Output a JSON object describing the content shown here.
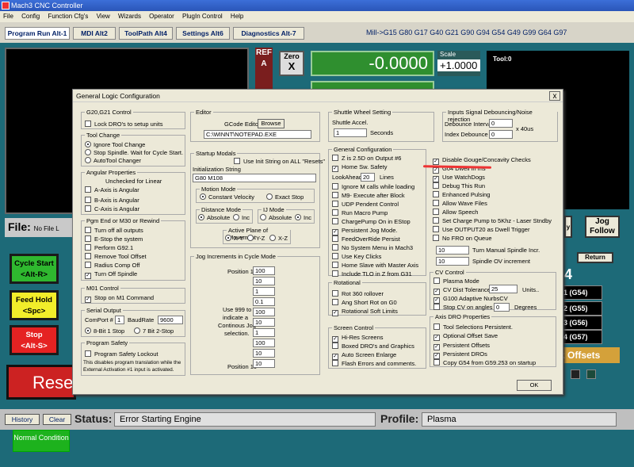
{
  "window": {
    "title": "Mach3 CNC Controller"
  },
  "menu": [
    "File",
    "Config",
    "Function Cfg's",
    "View",
    "Wizards",
    "Operator",
    "PlugIn Control",
    "Help"
  ],
  "tabs": [
    "Program Run Alt-1",
    "MDI Alt2",
    "ToolPath Alt4",
    "Settings Alt6",
    "Diagnostics Alt-7"
  ],
  "gcodes_line": "Mill->G15  G80 G17 G40 G21 G90 G94 G54 G49 G99 G64 G97",
  "ref_label": "REF A",
  "zero": {
    "line1": "Zero",
    "line2": "X"
  },
  "dro_value": "-0.0000",
  "scale": {
    "label": "Scale",
    "value": "+1.0000"
  },
  "tool_label": "Tool:0",
  "file": {
    "label": "File:",
    "value": "No File L"
  },
  "left_buttons": {
    "cycle_start": "Cycle Start",
    "cycle_key": "<Alt-R>",
    "feed_hold": "Feed Hold",
    "feed_key": "<Spc>",
    "stop": "Stop",
    "stop_key": "<Alt-S>",
    "reset": "Rese"
  },
  "right_panel": {
    "jog_follow": "Jog Follow",
    "jog_partial": "y",
    "return": "Return",
    "g_buttons": [
      "1 (G54)",
      "2 (G55)",
      "3 (G56)",
      "4 (G57)"
    ],
    "big_digit": "4",
    "offsets": "k Offsets"
  },
  "status": {
    "history": "History",
    "clear": "Clear",
    "status_label": "Status:",
    "status_value": "Error Starting Engine",
    "profile_label": "Profile:",
    "profile_value": "Plasma"
  },
  "normal_condition": "Normal Condition",
  "dialog": {
    "title": "General Logic Configuration",
    "close": "x",
    "g20_g21": {
      "title": "G20,G21 Control",
      "item": "Lock DRO's to setup units"
    },
    "tool_change": {
      "title": "Tool Change",
      "options": [
        "Ignore Tool Change",
        "Stop Spindle. Wait for Cycle Start.",
        "AutoTool Changer"
      ]
    },
    "angular": {
      "title": "Angular Properties",
      "note": "Unchecked for Linear",
      "items": [
        "A-Axis is Angular",
        "B-Axis is Angular",
        "C-Axis is Angular"
      ]
    },
    "pgm_end": {
      "title": "Pgm End or M30 or Rewind",
      "items": [
        "Turn off all outputs",
        "E-Stop the system",
        "Perform G92.1",
        "Remove Tool Offset",
        "Radius Comp Off",
        "Turn Off Spindle"
      ]
    },
    "m01": {
      "title": "M01 Control",
      "item": "Stop on M1 Command"
    },
    "serial": {
      "title": "Serial Output",
      "comport_label": "ComPort #",
      "comport": "1",
      "baud_label": "BaudRate",
      "baud": "9600",
      "opt1": "8-Bit 1 Stop",
      "opt2": "7 Bit 2-Stop"
    },
    "safety": {
      "title": "Program Safety",
      "item": "Program Safety Lockout",
      "note1": "This disables program translation while the",
      "note2": "External Activation #1 input is activated."
    },
    "editor": {
      "title": "Editor",
      "label": "GCode Editor",
      "browse": "Browse",
      "path": "C:\\WINNT\\NOTEPAD.EXE"
    },
    "startup": {
      "title": "Startup Modals",
      "use_init": "Use Init String on ALL  \"Resets\"",
      "init_label": "Initialization String",
      "init_value": "G80 M108"
    },
    "motion": {
      "title": "Motion Mode",
      "opt1": "Constant Velocity",
      "opt2": "Exact Stop"
    },
    "distance": {
      "title": "Distance Mode",
      "opt1": "Absolute",
      "opt2": "Inc"
    },
    "ij": {
      "title": "IJ Mode",
      "opt1": "Absolute",
      "opt2": "Inc"
    },
    "plane": {
      "title": "Active Plane of Movement",
      "opts": [
        "X-Y",
        "Y-Z",
        "X-Z"
      ]
    },
    "jog_inc": {
      "title": "Jog Increments in Cycle Mode",
      "pos1": "Position 1",
      "pos10": "Position 10",
      "values": [
        "100",
        "10",
        "1",
        "0.1",
        "100",
        "10",
        "1",
        "100",
        "10",
        "10"
      ],
      "desc1": "Use 999 to",
      "desc2": "indicate a",
      "desc3": "Continous Jog",
      "desc4": "selection."
    },
    "shuttle": {
      "title": "Shuttle Wheel Setting",
      "accel_label": "Shuttle Accel.",
      "accel": "1",
      "seconds": "Seconds"
    },
    "general": {
      "title": "General Configuration",
      "items1": [
        "Z is 2.5D  on Output #6",
        "Home Sw. Safety"
      ],
      "lookahead_label": "LookAhead",
      "lookahead": "20",
      "lines": "Lines",
      "items2": [
        "Ignore M calls while loading",
        "M9- Execute after Block",
        "UDP Pendent Control",
        "Run Macro Pump",
        "ChargePump On in EStop",
        "Persistent Jog Mode.",
        "FeedOverRide Persist",
        "No System Menu in Mach3",
        "Use Key Clicks",
        "Home Slave with Master Axis",
        "Include TLO in Z from G31"
      ]
    },
    "rotational": {
      "title": "Rotational",
      "items": [
        "Rot 360 rollover",
        "Ang Short Rot on G0",
        "Rotational Soft Limits"
      ]
    },
    "screen": {
      "title": "Screen Control",
      "items": [
        "Hi-Res Screens",
        "Boxed DRO's and Graphics",
        "Auto Screen Enlarge",
        "Flash Errors and comments."
      ]
    },
    "inputs": {
      "title": "Inputs Signal Debouncing/Noise rejection",
      "debounce_label": "Debounce Interval",
      "debounce": "0",
      "index_label": "Index Debounce",
      "index": "0",
      "unit": "x 40us"
    },
    "right_col": {
      "items": [
        "Disable Gouge/Concavity Checks",
        "G04 Dwell in ms",
        "Use WatchDogs",
        "Debug This Run",
        "Enhanced Pulsing",
        "Allow Wave Files",
        "Allow Speech",
        "Set Charge Pump to 5Khz - Laser Stndby",
        "Use OUTPUT20 as Dwell Trigger",
        "No FRO on Queue"
      ],
      "tm_label": "Turn Manual Spindle Incr.",
      "tm_value": "10",
      "sov_label": "Spindle OV increment",
      "sov_value": "10"
    },
    "cv": {
      "title": "CV Control",
      "items": [
        "Plasma Mode",
        "CV Dist Tolerance",
        "G100 Adaptive NurbsCV",
        "Stop CV on angles >"
      ],
      "tol": "25",
      "units": "Units..",
      "angle": "0",
      "degrees": "Degrees"
    },
    "axis_dro": {
      "title": "Axis DRO Properties",
      "items": [
        "Tool Selections Persistent.",
        "Optional Offset Save",
        "Persistent Offsets",
        "Persistent DROs",
        "Copy G54 from G59.253 on startup"
      ]
    },
    "ok": "OK"
  }
}
